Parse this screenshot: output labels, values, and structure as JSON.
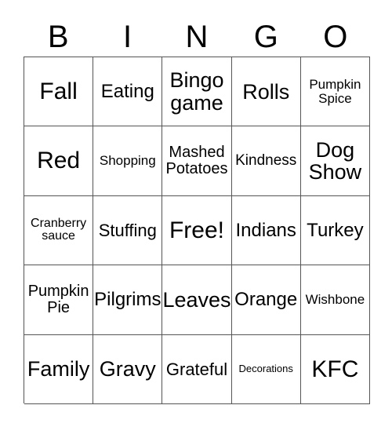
{
  "card": {
    "title_letters": [
      "B",
      "I",
      "N",
      "G",
      "O"
    ],
    "colors": {
      "text": "#000000",
      "border": "#555555",
      "background": "#ffffff"
    },
    "rows": [
      [
        {
          "text": "Fall",
          "size": "fs-xxl"
        },
        {
          "text": "Eating",
          "size": "fs-lg2"
        },
        {
          "text": "Bingo\ngame",
          "size": "fs-xl"
        },
        {
          "text": "Rolls",
          "size": "fs-xl"
        },
        {
          "text": "Pumpkin\nSpice",
          "size": "fs-sm2"
        }
      ],
      [
        {
          "text": "Red",
          "size": "fs-xxl"
        },
        {
          "text": "Shopping",
          "size": "fs-sm2"
        },
        {
          "text": "Mashed\nPotatoes",
          "size": "fs-md2"
        },
        {
          "text": "Kindness",
          "size": "fs-md"
        },
        {
          "text": "Dog\nShow",
          "size": "fs-xl"
        }
      ],
      [
        {
          "text": "Cranberry\nsauce",
          "size": "fs-sm"
        },
        {
          "text": "Stuffing",
          "size": "fs-lg"
        },
        {
          "text": "Free!",
          "size": "fs-xxl"
        },
        {
          "text": "Indians",
          "size": "fs-lg2"
        },
        {
          "text": "Turkey",
          "size": "fs-lg2"
        }
      ],
      [
        {
          "text": "Pumpkin\nPie",
          "size": "fs-md2"
        },
        {
          "text": "Pilgrims",
          "size": "fs-lg2"
        },
        {
          "text": "Leaves",
          "size": "fs-xl"
        },
        {
          "text": "Orange",
          "size": "fs-lg2"
        },
        {
          "text": "Wishbone",
          "size": "fs-sm2"
        }
      ],
      [
        {
          "text": "Family",
          "size": "fs-xl"
        },
        {
          "text": "Gravy",
          "size": "fs-xl"
        },
        {
          "text": "Grateful",
          "size": "fs-lg"
        },
        {
          "text": "Decorations",
          "size": "fs-xs"
        },
        {
          "text": "KFC",
          "size": "fs-xxl"
        }
      ]
    ]
  }
}
